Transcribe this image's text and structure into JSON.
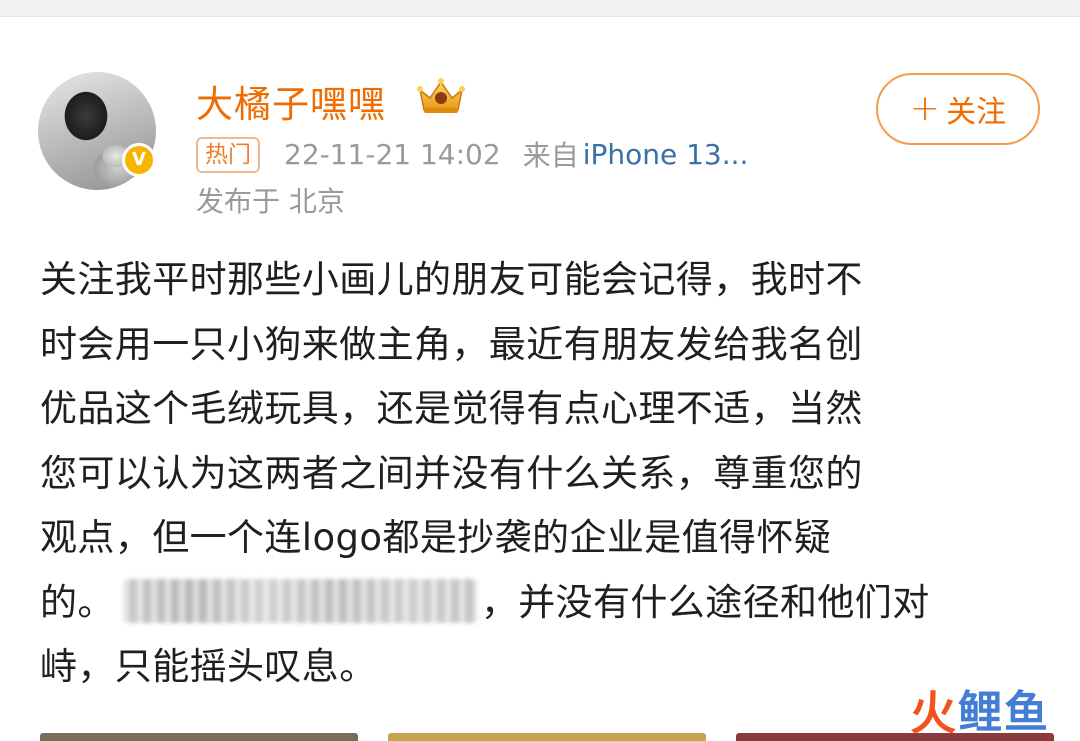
{
  "post": {
    "username": "大橘子嘿嘿",
    "follow_label": "关注",
    "hot_badge": "热门",
    "time": "22-11-21 14:02",
    "source_prefix": "来自",
    "source_device": "iPhone 13...",
    "location": "发布于 北京",
    "body_lines": [
      "关注我平时那些小画儿的朋友可能会记得，我时不",
      "时会用一只小狗来做主角，最近有朋友发给我名创",
      "优品这个毛绒玩具，还是觉得有点心理不适，当然",
      "您可以认为这两者之间并没有什么关系，尊重您的",
      "观点，但一个连logo都是抄袭的企业是值得怀疑",
      "的。",
      "，并没有什么途径和他们对",
      "峙，只能摇头叹息。"
    ]
  },
  "icons": {
    "verified": "verified-v-icon",
    "crown": "crown-icon",
    "plus": "plus-icon"
  },
  "colors": {
    "username": "#f06c00",
    "link": "#3b6fa6",
    "meta": "#9a9a9a",
    "badge_gold": "#f7b500"
  },
  "watermark": {
    "fire": "火",
    "text": "鲤鱼"
  }
}
